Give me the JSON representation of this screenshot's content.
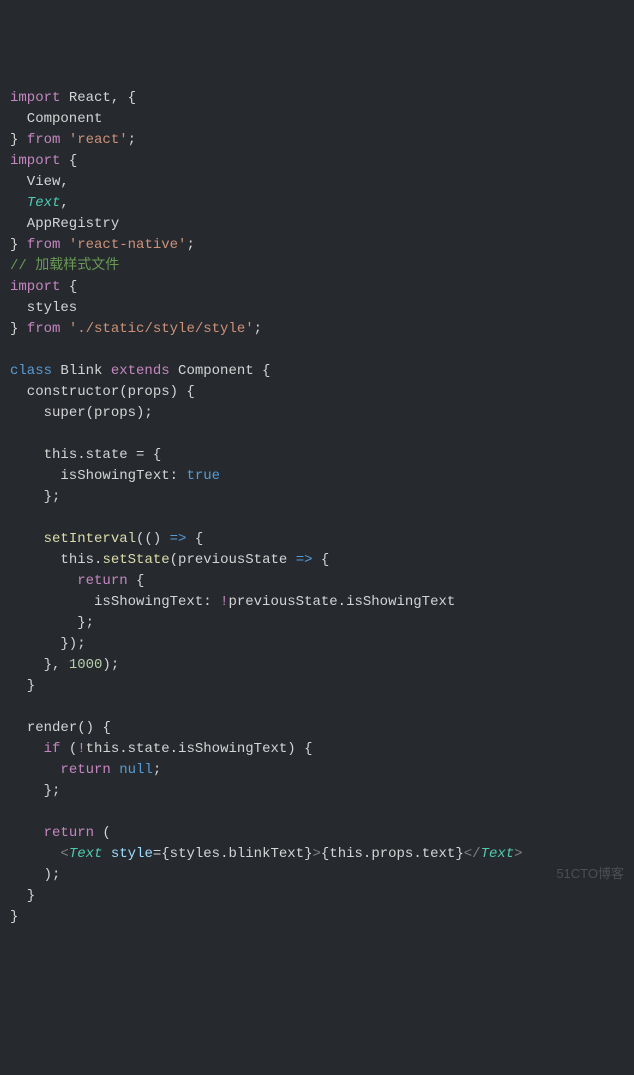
{
  "chart_data": null,
  "code": {
    "lines": [
      {
        "tokens": [
          {
            "t": "import",
            "c": "keyword-import"
          },
          {
            "t": " React, {",
            "c": "punct"
          }
        ]
      },
      {
        "tokens": [
          {
            "t": "  Component",
            "c": "identifier"
          }
        ]
      },
      {
        "tokens": [
          {
            "t": "} ",
            "c": "punct"
          },
          {
            "t": "from",
            "c": "keyword-from"
          },
          {
            "t": " ",
            "c": "punct"
          },
          {
            "t": "'react'",
            "c": "string"
          },
          {
            "t": ";",
            "c": "punct"
          }
        ]
      },
      {
        "tokens": [
          {
            "t": "import",
            "c": "keyword-import"
          },
          {
            "t": " {",
            "c": "punct"
          }
        ]
      },
      {
        "tokens": [
          {
            "t": "  View,",
            "c": "identifier"
          }
        ]
      },
      {
        "tokens": [
          {
            "t": "  ",
            "c": "punct"
          },
          {
            "t": "Text",
            "c": "type-text"
          },
          {
            "t": ",",
            "c": "punct"
          }
        ]
      },
      {
        "tokens": [
          {
            "t": "  AppRegistry",
            "c": "identifier"
          }
        ]
      },
      {
        "tokens": [
          {
            "t": "} ",
            "c": "punct"
          },
          {
            "t": "from",
            "c": "keyword-from"
          },
          {
            "t": " ",
            "c": "punct"
          },
          {
            "t": "'react-native'",
            "c": "string"
          },
          {
            "t": ";",
            "c": "punct"
          }
        ]
      },
      {
        "tokens": [
          {
            "t": "// 加载样式文件",
            "c": "comment-cn"
          }
        ]
      },
      {
        "tokens": [
          {
            "t": "import",
            "c": "keyword-import"
          },
          {
            "t": " {",
            "c": "punct"
          }
        ]
      },
      {
        "tokens": [
          {
            "t": "  styles",
            "c": "identifier"
          }
        ]
      },
      {
        "tokens": [
          {
            "t": "} ",
            "c": "punct"
          },
          {
            "t": "from",
            "c": "keyword-from"
          },
          {
            "t": " ",
            "c": "punct"
          },
          {
            "t": "'./static/style/style'",
            "c": "string"
          },
          {
            "t": ";",
            "c": "punct"
          }
        ]
      },
      {
        "tokens": []
      },
      {
        "tokens": [
          {
            "t": "class",
            "c": "keyword-class"
          },
          {
            "t": " Blink ",
            "c": "classname"
          },
          {
            "t": "extends",
            "c": "keyword-extends"
          },
          {
            "t": " Component {",
            "c": "punct"
          }
        ]
      },
      {
        "tokens": [
          {
            "t": "  constructor(props) {",
            "c": "identifier"
          }
        ]
      },
      {
        "tokens": [
          {
            "t": "    ",
            "c": "punct"
          },
          {
            "t": "super",
            "c": "keyword-super"
          },
          {
            "t": "(props);",
            "c": "punct"
          }
        ]
      },
      {
        "tokens": []
      },
      {
        "tokens": [
          {
            "t": "    ",
            "c": "punct"
          },
          {
            "t": "this",
            "c": "keyword-this"
          },
          {
            "t": ".state = {",
            "c": "punct"
          }
        ]
      },
      {
        "tokens": [
          {
            "t": "      isShowingText: ",
            "c": "identifier"
          },
          {
            "t": "true",
            "c": "keyword-true"
          }
        ]
      },
      {
        "tokens": [
          {
            "t": "    };",
            "c": "punct"
          }
        ]
      },
      {
        "tokens": []
      },
      {
        "tokens": [
          {
            "t": "    ",
            "c": "punct"
          },
          {
            "t": "setInterval",
            "c": "func-call"
          },
          {
            "t": "(() ",
            "c": "punct"
          },
          {
            "t": "=>",
            "c": "arrow"
          },
          {
            "t": " {",
            "c": "punct"
          }
        ]
      },
      {
        "tokens": [
          {
            "t": "      ",
            "c": "punct"
          },
          {
            "t": "this",
            "c": "keyword-this"
          },
          {
            "t": ".",
            "c": "punct"
          },
          {
            "t": "setState",
            "c": "func-call"
          },
          {
            "t": "(previousState ",
            "c": "punct"
          },
          {
            "t": "=>",
            "c": "arrow"
          },
          {
            "t": " {",
            "c": "punct"
          }
        ]
      },
      {
        "tokens": [
          {
            "t": "        ",
            "c": "punct"
          },
          {
            "t": "return",
            "c": "keyword-return"
          },
          {
            "t": " {",
            "c": "punct"
          }
        ]
      },
      {
        "tokens": [
          {
            "t": "          isShowingText: ",
            "c": "identifier"
          },
          {
            "t": "!",
            "c": "operator-not"
          },
          {
            "t": "previousState.isShowingText",
            "c": "identifier"
          }
        ]
      },
      {
        "tokens": [
          {
            "t": "        };",
            "c": "punct"
          }
        ]
      },
      {
        "tokens": [
          {
            "t": "      });",
            "c": "punct"
          }
        ]
      },
      {
        "tokens": [
          {
            "t": "    }, ",
            "c": "punct"
          },
          {
            "t": "1000",
            "c": "number"
          },
          {
            "t": ");",
            "c": "punct"
          }
        ]
      },
      {
        "tokens": [
          {
            "t": "  }",
            "c": "punct"
          }
        ]
      },
      {
        "tokens": []
      },
      {
        "tokens": [
          {
            "t": "  ",
            "c": "punct"
          },
          {
            "t": "render",
            "c": "keyword-render"
          },
          {
            "t": "() {",
            "c": "punct"
          }
        ]
      },
      {
        "tokens": [
          {
            "t": "    ",
            "c": "punct"
          },
          {
            "t": "if",
            "c": "keyword-if"
          },
          {
            "t": " (",
            "c": "punct"
          },
          {
            "t": "!",
            "c": "operator-not"
          },
          {
            "t": "this",
            "c": "keyword-this"
          },
          {
            "t": ".state.isShowingText) {",
            "c": "punct"
          }
        ]
      },
      {
        "tokens": [
          {
            "t": "      ",
            "c": "punct"
          },
          {
            "t": "return",
            "c": "keyword-return"
          },
          {
            "t": " ",
            "c": "punct"
          },
          {
            "t": "null",
            "c": "keyword-null"
          },
          {
            "t": ";",
            "c": "punct"
          }
        ]
      },
      {
        "tokens": [
          {
            "t": "    };",
            "c": "punct"
          }
        ]
      },
      {
        "tokens": []
      },
      {
        "tokens": [
          {
            "t": "    ",
            "c": "punct"
          },
          {
            "t": "return",
            "c": "keyword-return"
          },
          {
            "t": " (",
            "c": "punct"
          }
        ]
      },
      {
        "tokens": [
          {
            "t": "      ",
            "c": "punct"
          },
          {
            "t": "<",
            "c": "angle"
          },
          {
            "t": "Text",
            "c": "tag-name"
          },
          {
            "t": " ",
            "c": "punct"
          },
          {
            "t": "style",
            "c": "attr-name"
          },
          {
            "t": "={styles.blinkText}",
            "c": "punct"
          },
          {
            "t": ">",
            "c": "angle"
          },
          {
            "t": "{",
            "c": "punct"
          },
          {
            "t": "this",
            "c": "keyword-this"
          },
          {
            "t": ".props.text}",
            "c": "punct"
          },
          {
            "t": "</",
            "c": "angle"
          },
          {
            "t": "Text",
            "c": "tag-name"
          },
          {
            "t": ">",
            "c": "angle"
          }
        ]
      },
      {
        "tokens": [
          {
            "t": "    );",
            "c": "punct"
          }
        ]
      },
      {
        "tokens": [
          {
            "t": "  }",
            "c": "punct"
          }
        ]
      },
      {
        "tokens": [
          {
            "t": "}",
            "c": "punct"
          }
        ]
      }
    ]
  },
  "watermark": "51CTO博客"
}
